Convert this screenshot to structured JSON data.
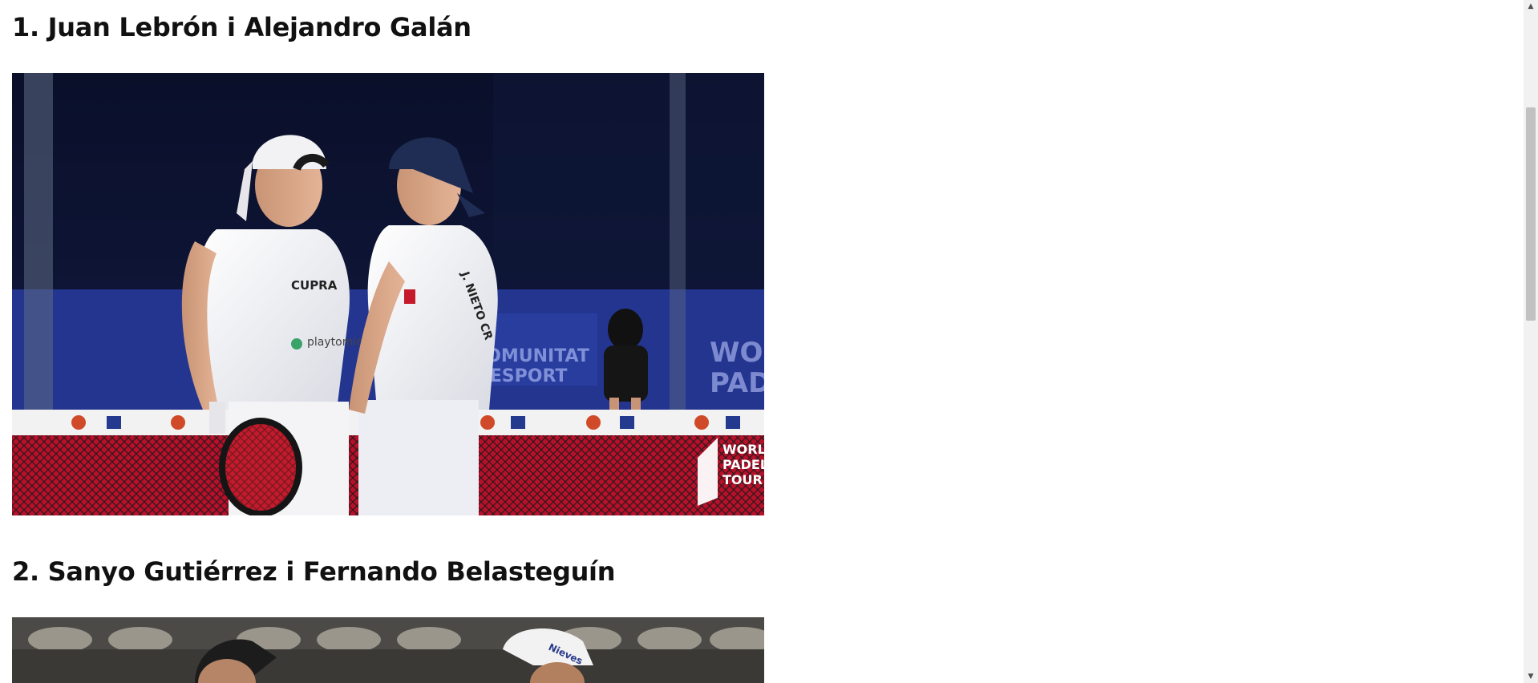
{
  "entries": [
    {
      "title": "1. Juan Lebrón i Alejandro Galán",
      "photo_labels": {
        "shirt_brand": "CUPRA",
        "sponsor": "playtomic",
        "shirt_name": "J. NIETO CR",
        "watermark_line1": "WORLD",
        "watermark_line2": "PADEL",
        "watermark_line3": "TOUR",
        "banner_text_1": "COMUNITAT",
        "banner_text_2": "L'ESPORT",
        "banner_text_3": "WOR",
        "banner_text_4": "PAD"
      }
    },
    {
      "title": "2. Sanyo Gutiérrez i Fernando Belasteguín",
      "photo_labels": {
        "cap_text": "Nieves"
      }
    }
  ],
  "scrollbar": {
    "up_icon": "scroll-up-arrow-icon",
    "down_icon": "scroll-down-arrow-icon"
  }
}
